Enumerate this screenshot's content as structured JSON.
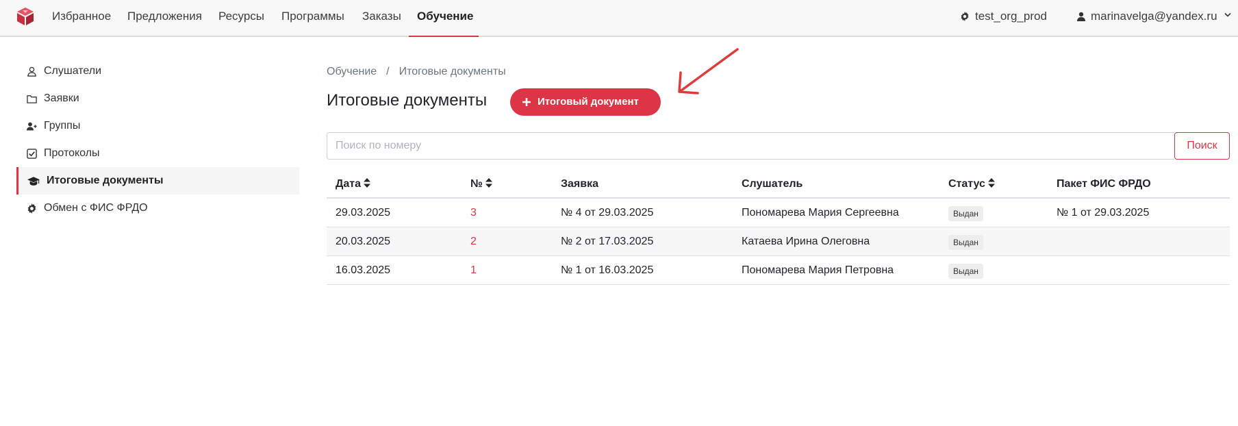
{
  "navbar": {
    "items": [
      {
        "label": "Избранное"
      },
      {
        "label": "Предложения"
      },
      {
        "label": "Ресурсы"
      },
      {
        "label": "Программы"
      },
      {
        "label": "Заказы"
      },
      {
        "label": "Обучение",
        "active": true
      }
    ],
    "org": "test_org_prod",
    "user": "marinavelga@yandex.ru",
    "accent": "#dc3545"
  },
  "sidebar": {
    "items": [
      {
        "label": "Слушатели",
        "icon": "user-icon"
      },
      {
        "label": "Заявки",
        "icon": "folder-icon"
      },
      {
        "label": "Группы",
        "icon": "user-plus-icon"
      },
      {
        "label": "Протоколы",
        "icon": "check-square-icon"
      },
      {
        "label": "Итоговые документы",
        "icon": "graduation-cap-icon",
        "active": true
      },
      {
        "label": "Обмен с ФИС ФРДО",
        "icon": "gear-icon"
      }
    ]
  },
  "breadcrumb": {
    "items": [
      "Обучение",
      "Итоговые документы"
    ],
    "separator": "/"
  },
  "page": {
    "title": "Итоговые документы",
    "add_button": "Итоговый документ"
  },
  "search": {
    "placeholder": "Поиск по номеру",
    "value": "",
    "button": "Поиск"
  },
  "table": {
    "columns": [
      {
        "label": "Дата",
        "sortable": true
      },
      {
        "label": "№",
        "sortable": true
      },
      {
        "label": "Заявка",
        "sortable": false
      },
      {
        "label": "Слушатель",
        "sortable": false
      },
      {
        "label": "Статус",
        "sortable": true
      },
      {
        "label": "Пакет ФИС ФРДО",
        "sortable": false
      }
    ],
    "rows": [
      {
        "date": "29.03.2025",
        "number": "3",
        "request": "№ 4 от 29.03.2025",
        "student": "Пономарева Мария Сергеевна",
        "status": "Выдан",
        "package": "№ 1 от 29.03.2025"
      },
      {
        "date": "20.03.2025",
        "number": "2",
        "request": "№ 2 от 17.03.2025",
        "student": "Катаева Ирина Олеговна",
        "status": "Выдан",
        "package": ""
      },
      {
        "date": "16.03.2025",
        "number": "1",
        "request": "№ 1 от 16.03.2025",
        "student": "Пономарева Мария Петровна",
        "status": "Выдан",
        "package": ""
      }
    ]
  }
}
